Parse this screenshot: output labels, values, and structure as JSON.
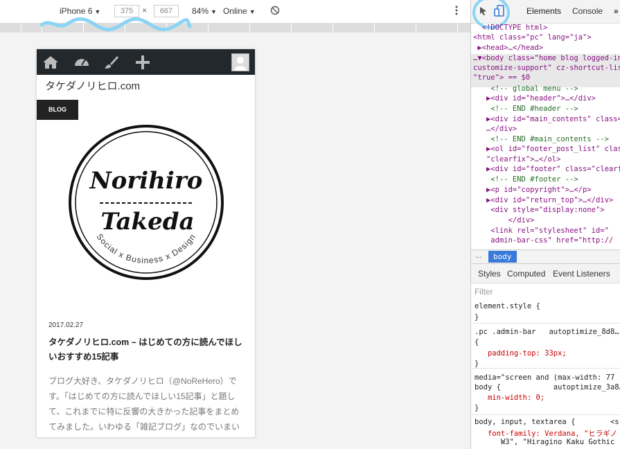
{
  "devicebar": {
    "device": "iPhone 6",
    "width": "375",
    "times": "×",
    "height": "667",
    "zoom": "84%",
    "network": "Online"
  },
  "page": {
    "site_title": "タケダノリヒロ.com",
    "category": "BLOG",
    "logo_line1": "Norihiro",
    "logo_line2": "Takeda",
    "logo_tagline": "Social x Business x Design",
    "post_date": "2017.02.27",
    "post_title": "タケダノリヒロ.com – はじめての方に読んでほしいおすすめ15記事",
    "post_excerpt": "ブログ大好き、タケダノリヒロ（@NoReHero）です。「はじめての方に読んでほしい15記事」と題して、これまでに特に反響の大きかった記事をまとめてみました。いわゆる「雑記ブログ」なのでいまいち"
  },
  "devtools": {
    "tabs": [
      "Elements",
      "Console"
    ],
    "more": "»",
    "crumb": "body",
    "crumb_dots": "...",
    "subtabs": [
      "Styles",
      "Computed",
      "Event Listeners"
    ],
    "filter_placeholder": "Filter"
  },
  "dom_lines": [
    "  <!DOCTYPE html>",
    "<html class=\"pc\" lang=\"ja\">",
    " ▶<head>…</head>",
    "…▼<body class=\"home blog logged-in admin-bar",
    "customize-support\" cz-shortcut-listen=",
    "\"true\"> == $0",
    "    <!-- global menu -->",
    "   ▶<div id=\"header\">…</div>",
    "    <!-- END #header -->",
    "   ▶<div id=\"main_contents\" class=\"clearfix\">",
    "   …</div>",
    "    <!-- END #main_contents -->",
    "   ▶<ol id=\"footer_post_list\" class=",
    "   \"clearfix\">…</ol>",
    "   ▶<div id=\"footer\" class=\"clearfix\">",
    "    <!-- END #footer -->",
    "   ▶<p id=\"copyright\">…</p>",
    "   ▶<div id=\"return_top\">…</div>",
    "    <div style=\"display:none\">",
    "        </div>",
    "    <link rel=\"stylesheet\" id=\"",
    "    admin-bar-css\" href=\"http://"
  ],
  "style_lines": [
    "element.style {",
    "}",
    ".pc .admin-bar   autoptimize_8d8…",
    "{",
    "   padding-top: 33px;",
    "}",
    "media=\"screen and (max-width: 77",
    "body {            autoptimize_3a8…",
    "   min-width: 0;",
    "}",
    "body, input, textarea {        <s",
    "   font-family: Verdana, \"ヒラギノ",
    "      W3\", \"Hiragino Kaku Gothic"
  ],
  "colors": {
    "admin_bar": "#23282d",
    "highlight": "#8bd4f5",
    "selected_crumb": "#3879d9"
  }
}
